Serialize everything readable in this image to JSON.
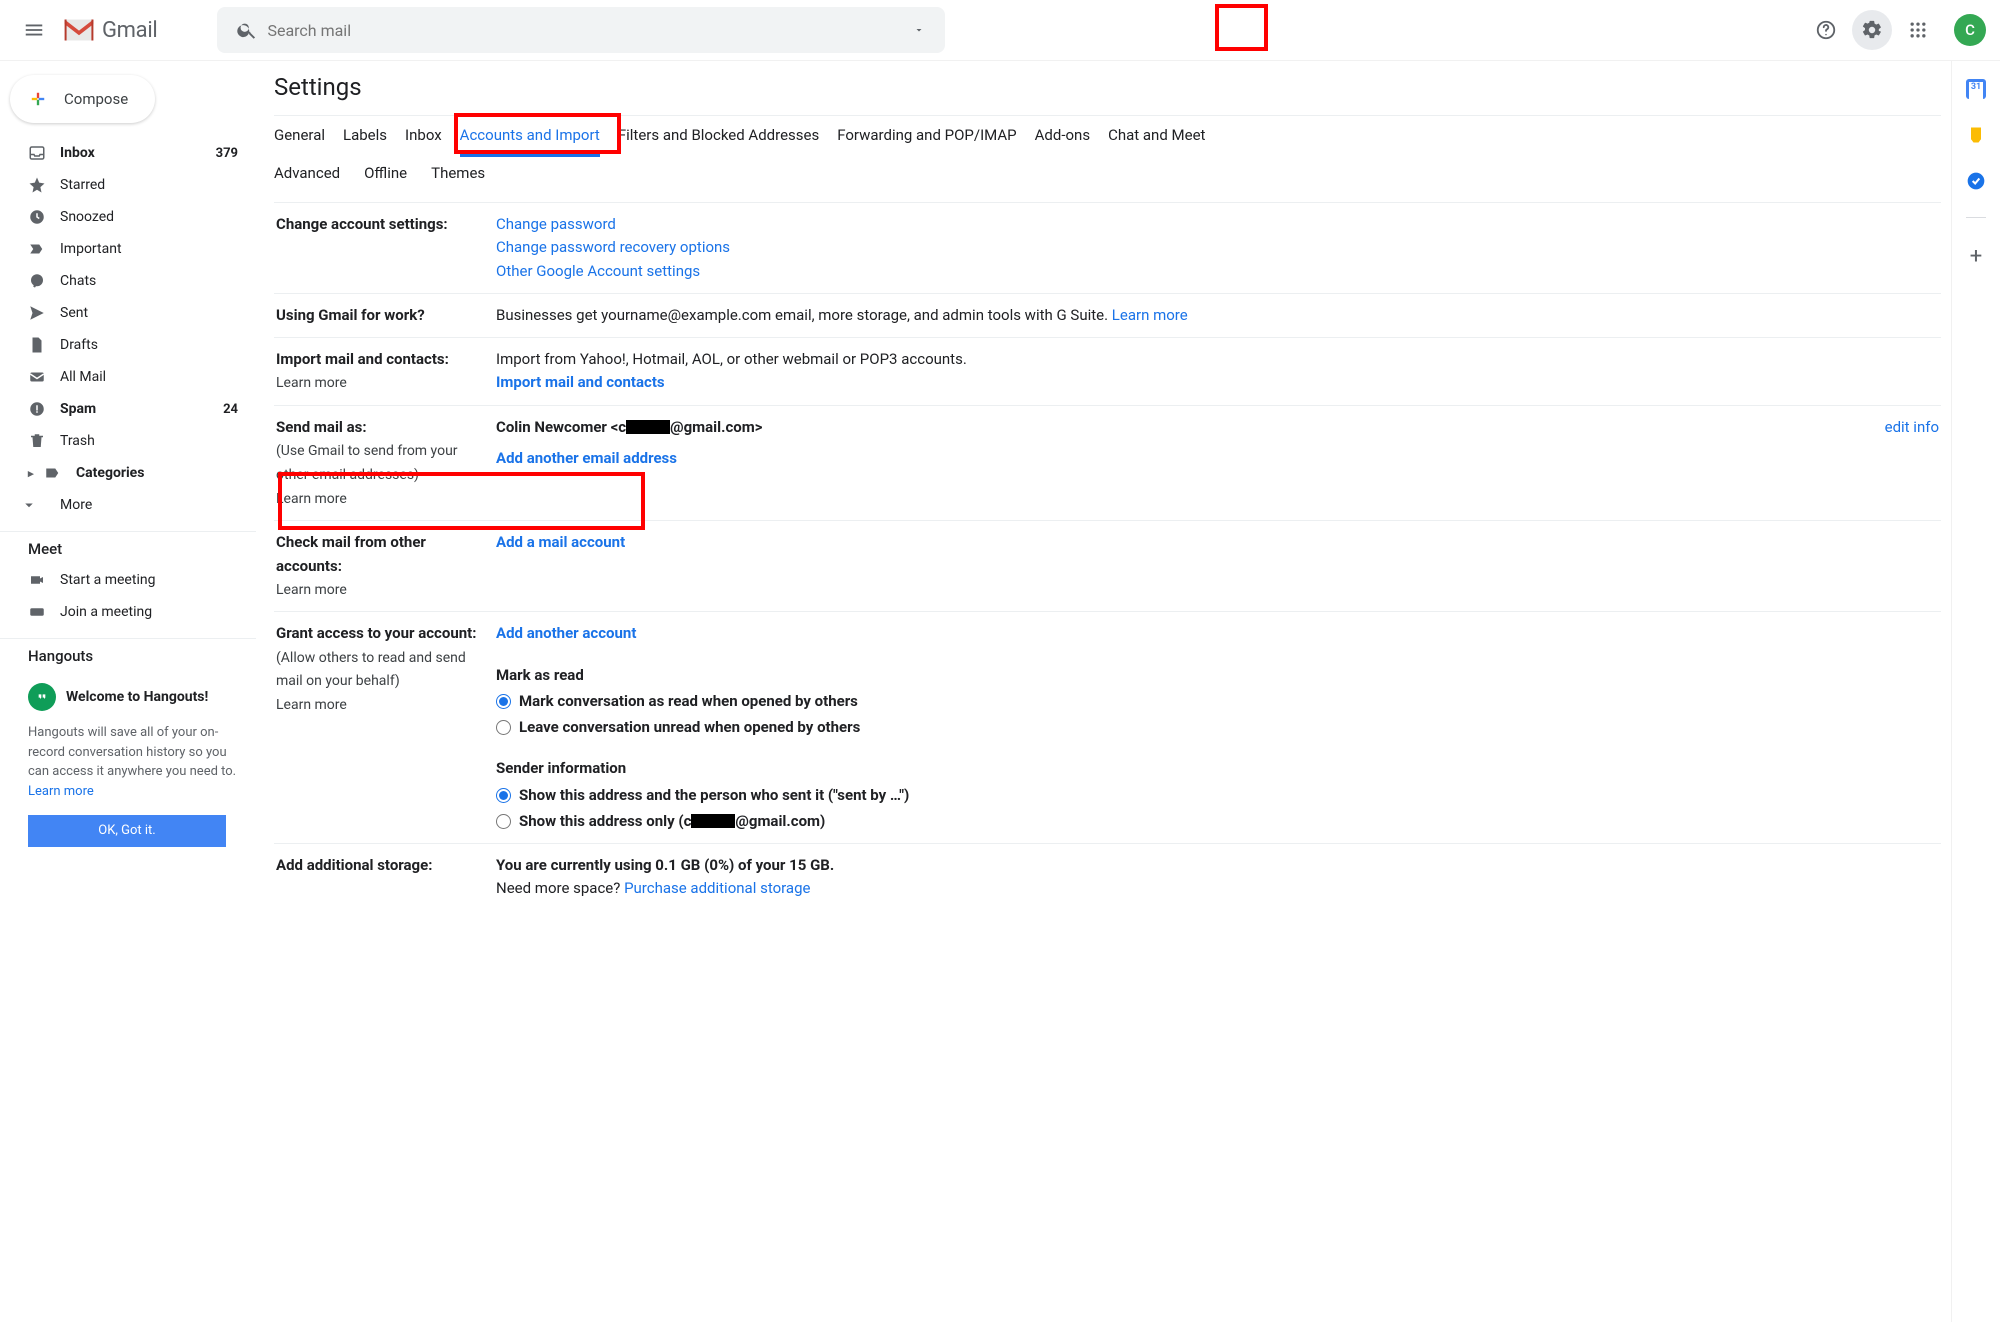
{
  "header": {
    "logo_text": "Gmail",
    "search_placeholder": "Search mail",
    "avatar_letter": "C"
  },
  "sidebar": {
    "compose": "Compose",
    "items": [
      {
        "label": "Inbox",
        "count": "379",
        "bold": true
      },
      {
        "label": "Starred"
      },
      {
        "label": "Snoozed"
      },
      {
        "label": "Important"
      },
      {
        "label": "Chats"
      },
      {
        "label": "Sent"
      },
      {
        "label": "Drafts"
      },
      {
        "label": "All Mail"
      },
      {
        "label": "Spam",
        "count": "24",
        "bold": true
      },
      {
        "label": "Trash"
      },
      {
        "label": "Categories",
        "bold": true
      },
      {
        "label": "More"
      }
    ],
    "meet": {
      "title": "Meet",
      "start": "Start a meeting",
      "join": "Join a meeting"
    },
    "hangouts": {
      "title": "Hangouts",
      "card_title": "Welcome to Hangouts!",
      "body1": "Hangouts will save all of your on-record conversation history so you can access it anywhere you need to. ",
      "learn": "Learn more",
      "ok": "OK, Got it."
    }
  },
  "main": {
    "title": "Settings",
    "tabs": [
      "General",
      "Labels",
      "Inbox",
      "Accounts and Import",
      "Filters and Blocked Addresses",
      "Forwarding and POP/IMAP",
      "Add-ons",
      "Chat and Meet"
    ],
    "tabs2": [
      "Advanced",
      "Offline",
      "Themes"
    ],
    "rows": {
      "change": {
        "label": "Change account settings:",
        "l1": "Change password",
        "l2": "Change password recovery options",
        "l3": "Other Google Account settings"
      },
      "work": {
        "label": "Using Gmail for work?",
        "text": "Businesses get yourname@example.com email, more storage, and admin tools with G Suite. ",
        "link": "Learn more"
      },
      "import": {
        "label": "Import mail and contacts:",
        "learn": "Learn more",
        "text": "Import from Yahoo!, Hotmail, AOL, or other webmail or POP3 accounts.",
        "action": "Import mail and contacts"
      },
      "send": {
        "label": "Send mail as:",
        "sub": "(Use Gmail to send from your other email addresses)",
        "learn": "Learn more",
        "name": "Colin Newcomer <c",
        "domain": "@gmail.com>",
        "edit": "edit info",
        "add": "Add another email address"
      },
      "check": {
        "label": "Check mail from other accounts:",
        "learn": "Learn more",
        "add": "Add a mail account"
      },
      "grant": {
        "label": "Grant access to your account:",
        "sub": "(Allow others to read and send mail on your behalf)",
        "learn": "Learn more",
        "add": "Add another account",
        "mark_head": "Mark as read",
        "r1": "Mark conversation as read when opened by others",
        "r2": "Leave conversation unread when opened by others",
        "sender_head": "Sender information",
        "r3": "Show this address and the person who sent it (\"sent by …\")",
        "r4a": "Show this address only (c",
        "r4b": "@gmail.com)"
      },
      "storage": {
        "label": "Add additional storage:",
        "text": "You are currently using 0.1 GB (0%) of your 15 GB.",
        "need": "Need more space? ",
        "link": "Purchase additional storage"
      }
    }
  }
}
